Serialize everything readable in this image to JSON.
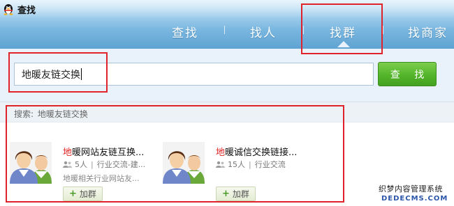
{
  "app": {
    "title": "查找"
  },
  "tabs": [
    {
      "label": "查找",
      "active": false
    },
    {
      "label": "找人",
      "active": false
    },
    {
      "label": "找群",
      "active": true
    },
    {
      "label": "找商家",
      "active": false
    }
  ],
  "search": {
    "query": "地暖友链交换",
    "button_label": "查  找"
  },
  "results": {
    "caption_prefix": "搜索:",
    "caption_query": "地暖友链交换",
    "cards": [
      {
        "name_highlight": "地",
        "name_rest": "暖网站友链互换...",
        "members": "5人",
        "category": "行业交流-建...",
        "description": "地暖相关行业网站友...",
        "join_label": "加群",
        "avatar_icon": "group-avatar-icon"
      },
      {
        "name_highlight": "地",
        "name_rest": "暖诚信交换链接...",
        "members": "15人",
        "category": "行业交流",
        "description": "",
        "join_label": "加群",
        "avatar_icon": "group-avatar-icon"
      }
    ]
  },
  "watermark": {
    "line1": "织梦内容管理系统",
    "line2": "DEDECMS.COM"
  },
  "colors": {
    "accent_green": "#53b52a",
    "highlight_red": "#e02020",
    "annotation_red": "#e0222a",
    "header_blue": "#7ab7e0"
  }
}
